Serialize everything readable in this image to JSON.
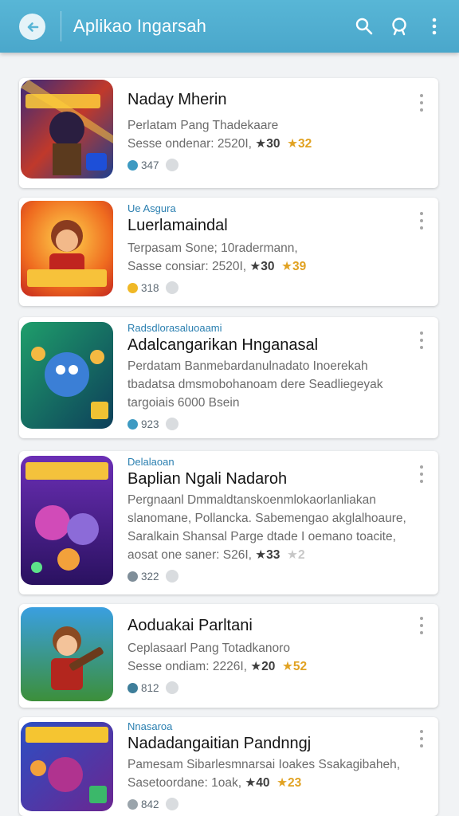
{
  "appbar": {
    "title": "Aplikao Ingarsah",
    "back_icon": "arrow-left-icon",
    "actions": [
      "search-icon",
      "account-icon",
      "more-vert-icon"
    ]
  },
  "colors": {
    "appbar": "#4fb0d2",
    "accent_tag": "#2a7fb0",
    "badge": "#e1a222"
  },
  "apps": [
    {
      "tag": "",
      "title": "Naday Mherin",
      "desc": [
        "Perlatam Pang Thadekaare"
      ],
      "meta_prefix": "Sesse ondenar: 2520I, ",
      "rating": "★30",
      "badge": "★32",
      "stat": "347"
    },
    {
      "tag": "Ue Asgura",
      "title": "Luerlamaindal",
      "desc": [
        "Terpasam Sone; 10radermann,"
      ],
      "meta_prefix": "Sasse consiar: 2520I, ",
      "rating": "★30",
      "badge": "★39",
      "stat": "318"
    },
    {
      "tag": "Radsdlorasaluoaami",
      "title": "Adalcangarikan Hnganasal",
      "desc": [
        "Perdatam Banmebardanulnadato Inoerekah",
        "tbadatsa dmsmobohanoam dere Seadliegeyak"
      ],
      "meta_prefix": "targoiais 6000 Bsein",
      "rating": "",
      "badge": "",
      "stat": "923"
    },
    {
      "tag": "Delalaoan",
      "title": "Baplian Ngali Nadaroh",
      "desc": [
        "Pergnaanl Dmmaldtanskoenmlokaorlanliakan",
        "slanomane, Pollancka. Sabemengao akglalhoaure,",
        "Saralkain Shansal Parge dtade I oemano toacite,"
      ],
      "meta_prefix": "aosat one saner: S26I, ",
      "rating": "★33",
      "badge": "★2",
      "stat": "322"
    },
    {
      "tag": "",
      "title": "Aoduakai Parltani",
      "desc": [
        "Ceplasaarl Pang Totadkanoro"
      ],
      "meta_prefix": "Sesse ondiam: 2226I, ",
      "rating": "★20",
      "badge": "★52",
      "stat": "812"
    },
    {
      "tag": "Nnasaroa",
      "title": "Nadadangaitian Pandnngj",
      "desc": [
        "Pamesam Sibarlesmnarsai Ioakes Ssakagibaheh,"
      ],
      "meta_prefix": "Sasetoordane: 1oak, ",
      "rating": "★40",
      "badge": "★23",
      "stat": "842"
    }
  ]
}
